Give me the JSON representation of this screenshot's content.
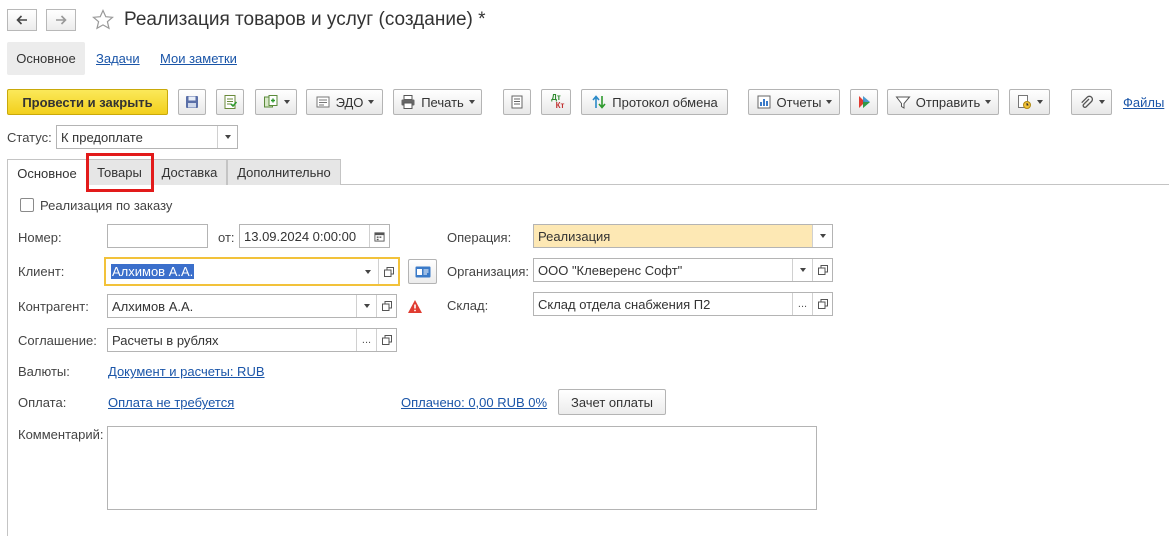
{
  "window": {
    "title": "Реализация товаров и услуг (создание) *"
  },
  "sections": {
    "active": "Основное",
    "links": [
      "Задачи",
      "Мои заметки"
    ]
  },
  "toolbar": {
    "post_close": "Провести и закрыть",
    "edo": "ЭДО",
    "print": "Печать",
    "exchange_protocol": "Протокол обмена",
    "reports": "Отчеты",
    "send": "Отправить",
    "files": "Файлы",
    "dt_kt_top": "Дт",
    "dt_kt_bottom": "Кт"
  },
  "status": {
    "label": "Статус:",
    "value": "К предоплате"
  },
  "tabs": [
    "Основное",
    "Товары",
    "Доставка",
    "Дополнительно"
  ],
  "form": {
    "by_order_label": "Реализация по заказу",
    "number_label": "Номер:",
    "number_value": "",
    "date_from_label": "от:",
    "date_value": "13.09.2024  0:00:00",
    "client_label": "Клиент:",
    "client_value": "Алхимов А.А.",
    "counterparty_label": "Контрагент:",
    "counterparty_value": "Алхимов А.А.",
    "agreement_label": "Соглашение:",
    "agreement_value": "Расчеты в рублях",
    "currency_label": "Валюты:",
    "currency_link": "Документ и расчеты: RUB",
    "payment_label": "Оплата:",
    "payment_link": "Оплата не требуется",
    "paid_link": "Оплачено: 0,00 RUB 0%",
    "offset_button": "Зачет оплаты",
    "comment_label": "Комментарий:",
    "comment_value": "",
    "operation_label": "Операция:",
    "operation_value": "Реализация",
    "organization_label": "Организация:",
    "organization_value": "ООО \"Клеверенс Софт\"",
    "warehouse_label": "Склад:",
    "warehouse_value": "Склад отдела снабжения П2"
  },
  "colors": {
    "primary_button": "#f2cf1c",
    "link": "#1a55a8",
    "highlight_border": "#f2c23a",
    "operation_bg": "#fde8b4",
    "annotation_red": "#e21a1a",
    "warning": "#e03c31"
  }
}
